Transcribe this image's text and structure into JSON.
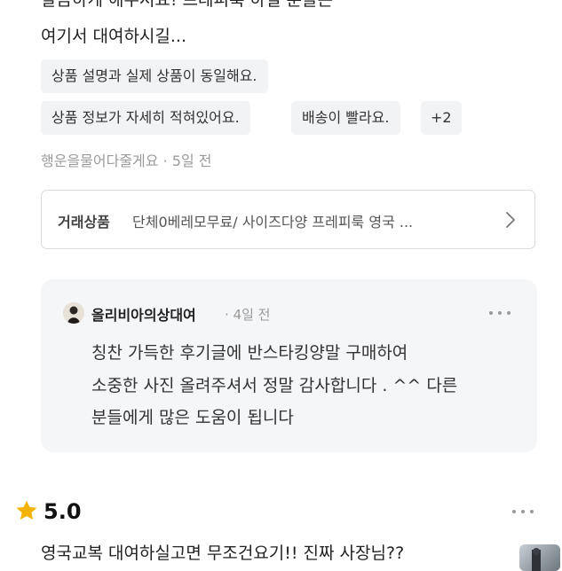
{
  "review1": {
    "lines": [
      "깔끔하게 해주셔요! 프레피룩 하실 분들은",
      "여기서 대여하시길..."
    ],
    "tags": [
      "상품 설명과 실제 상품이 동일해요.",
      "상품 정보가 자세히 적혀있어요.",
      "배송이 빨라요.",
      "+2"
    ],
    "author": "행운을물어다줄게요",
    "separator": "·",
    "time": "5일 전",
    "product": {
      "label": "거래상품",
      "title": "단체0베레모무료/ 사이즈다양 프레피룩 영국 ..."
    },
    "reply": {
      "name": "올리비아의상대여",
      "separator": "·",
      "time": "4일 전",
      "lines": [
        "칭찬 가득한 후기글에 반스타킹양말 구매하여",
        "소중한 사진 올려주셔서 정말 감사합니다 . ^^ 다른",
        "분들에게 많은 도움이 됩니다"
      ]
    }
  },
  "review2": {
    "rating": "5.0",
    "text": "영국교복 대여하실고면 무조건요기!! 진짜 사장님??"
  },
  "colors": {
    "star": "#f5b301",
    "chip_bg": "#f2f3f5",
    "reply_bg": "#f5f6f8",
    "muted_text": "#9a9a9a"
  },
  "icons": [
    "chevron-right-icon",
    "more-dots-icon",
    "star-icon",
    "avatar",
    "photo-thumbnail"
  ]
}
